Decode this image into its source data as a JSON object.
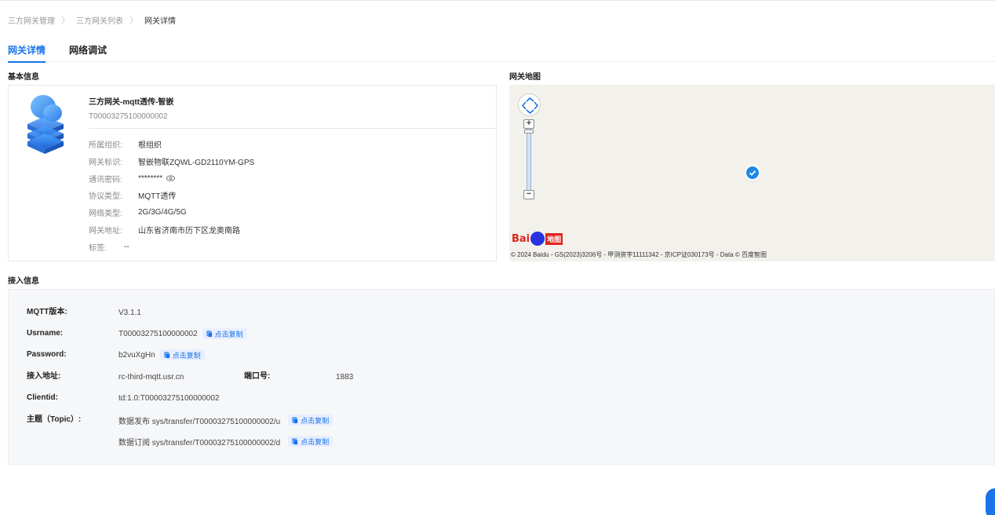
{
  "breadcrumb": {
    "items": [
      "三方网关管理",
      "三方网关列表",
      "网关详情"
    ],
    "separator": "〉"
  },
  "tabs": [
    {
      "label": "网关详情",
      "active": true
    },
    {
      "label": "网络调试",
      "active": false
    }
  ],
  "basic": {
    "title": "基本信息",
    "name": "三方网关-mqtt透传-智嵌",
    "id": "T00003275100000002",
    "fields": [
      {
        "label": "所属组织:",
        "value": "根组织"
      },
      {
        "label": "网关标识:",
        "value": "智嵌物联ZQWL-GD2110YM-GPS"
      },
      {
        "label": "通讯密码:",
        "value": "********"
      },
      {
        "label": "协议类型:",
        "value": "MQTT透传"
      },
      {
        "label": "网络类型:",
        "value": "2G/3G/4G/5G"
      },
      {
        "label": "网关地址:",
        "value": "山东省济南市历下区龙奥南路"
      },
      {
        "label": "标签:",
        "value": "--"
      }
    ]
  },
  "map": {
    "title": "网关地图",
    "zoom_in": "+",
    "zoom_out": "−",
    "logo_text": "Bai",
    "logo_suffix": "地图",
    "copyright": "© 2024 Baidu - GS(2023)3206号 - 甲测资字11111342 - 京ICP证030173号 - Data © 百度智图"
  },
  "access": {
    "title": "接入信息",
    "copy_label": "点击复制",
    "mqtt_version": {
      "label": "MQTT版本:",
      "value": "V3.1.1"
    },
    "username": {
      "label": "Usrname:",
      "value": "T00003275100000002"
    },
    "password": {
      "label": "Password:",
      "value": "b2vuXgHn"
    },
    "address": {
      "label": "接入地址:",
      "value": "rc-third-mqtt.usr.cn"
    },
    "port": {
      "label": "端口号:",
      "value": "1883"
    },
    "clientid": {
      "label": "Clientid:",
      "value": "td:1.0:T00003275100000002"
    },
    "topic": {
      "label": "主题（Topic）:",
      "publish": "数据发布 sys/transfer/T00003275100000002/u",
      "subscribe": "数据订阅 sys/transfer/T00003275100000002/d"
    }
  },
  "colors": {
    "accent": "#1a73e8",
    "marker": "#1e88e5",
    "panel_bg": "#f6f7f9"
  }
}
